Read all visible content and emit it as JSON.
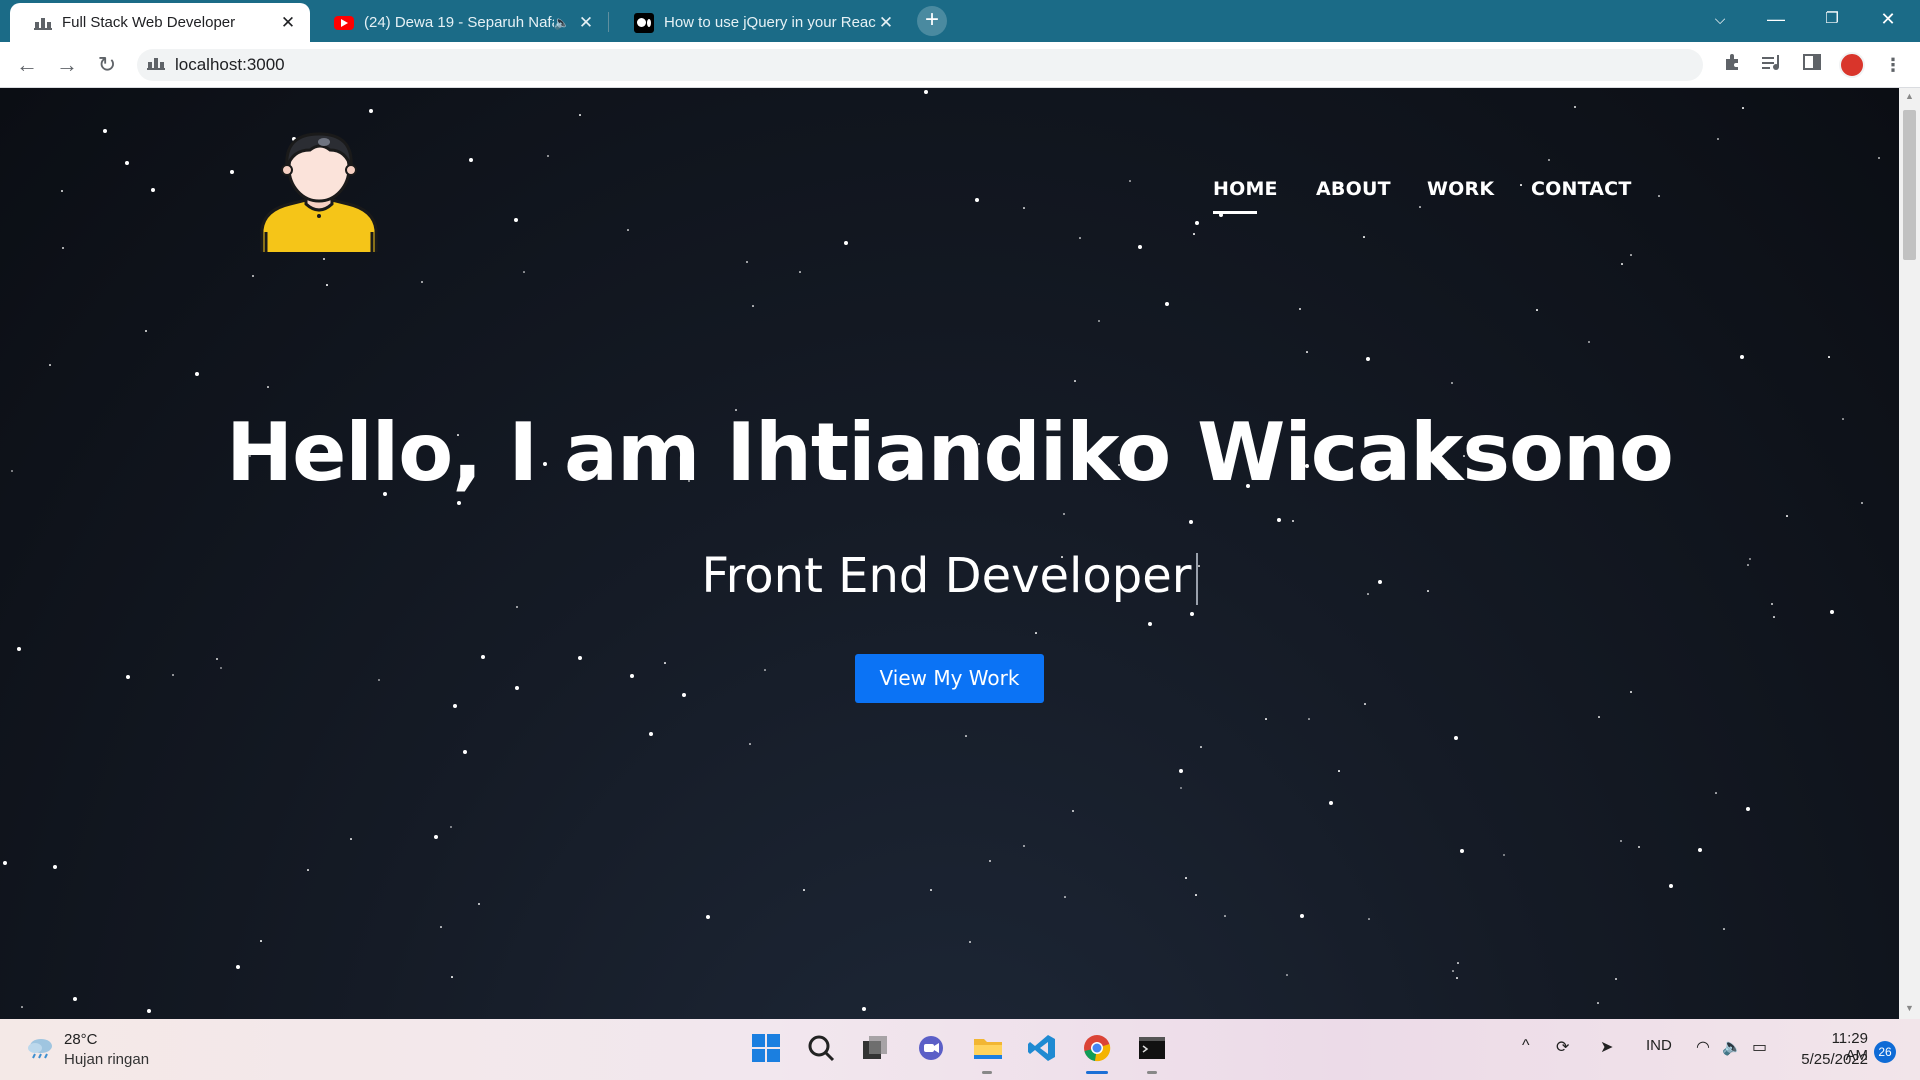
{
  "browser": {
    "tabs": [
      {
        "title": "Full Stack Web Developer",
        "favicon": "globe-icon",
        "active": true
      },
      {
        "title": "(24) Dewa 19 - Separuh Nafas",
        "favicon": "youtube-icon",
        "active": false,
        "audio": true
      },
      {
        "title": "How to use jQuery in your React",
        "favicon": "medium-icon",
        "active": false
      }
    ],
    "url": "localhost:3000",
    "accent_color": "#1b6b87"
  },
  "site": {
    "nav": {
      "items": [
        "HOME",
        "ABOUT",
        "WORK",
        "CONTACT"
      ],
      "active": "HOME"
    },
    "hero": {
      "title": "Hello, I am Ihtiandiko Wicaksono",
      "subtitle": "Front End Developer",
      "cta_label": "View My Work",
      "cta_color": "#0b73f5"
    },
    "logo_icon": "avatar-person-icon"
  },
  "taskbar": {
    "weather": {
      "temp": "28°C",
      "desc": "Hujan ringan"
    },
    "language": "IND",
    "time": "11:29 AM",
    "date": "5/25/2022",
    "notifications": "26"
  }
}
